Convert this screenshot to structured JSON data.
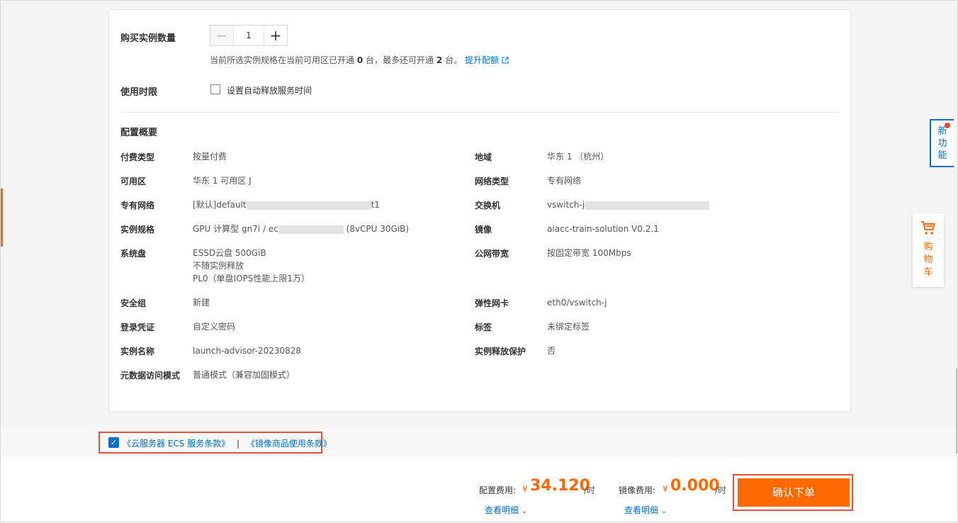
{
  "purchase": {
    "quantity_label": "购买实例数量",
    "quantity_value": "1",
    "quota_prefix": "当前所选实例规格在当前可用区已开通",
    "quota_open": "0",
    "quota_mid": "台，最多还可开通",
    "quota_more": "2",
    "quota_suffix": "台。",
    "quota_link": "提升配额"
  },
  "release": {
    "label": "使用时限",
    "checkbox_text": "设置自动释放服务时间"
  },
  "summary": {
    "title": "配置概要",
    "left": [
      {
        "key": "付费类型",
        "value": "按量付费"
      },
      {
        "key": "可用区",
        "value": "华东 1 可用区 J"
      },
      {
        "key": "专有网络",
        "value_prefix": "[默认]default",
        "value_suffix": "t1"
      },
      {
        "key": "实例规格",
        "value_prefix": "GPU 计算型 gn7i / ec",
        "value_suffix": "(8vCPU 30GiB)"
      },
      {
        "key": "系统盘",
        "lines": [
          "ESSD云盘 500GiB",
          "不随实例释放",
          "PL0（单盘IOPS性能上限1万）"
        ]
      },
      {
        "key": "安全组",
        "value": "新建"
      },
      {
        "key": "登录凭证",
        "value": "自定义密码"
      },
      {
        "key": "实例名称",
        "value": "launch-advisor-20230828"
      },
      {
        "key": "元数据访问模式",
        "value": "普通模式（兼容加固模式）"
      }
    ],
    "right": [
      {
        "key": "地域",
        "value": "华东 1 （杭州）"
      },
      {
        "key": "网络类型",
        "value": "专有网络"
      },
      {
        "key": "交换机",
        "value_prefix": "vswitch-j"
      },
      {
        "key": "镜像",
        "value": "aiacc-train-solution V0.2.1"
      },
      {
        "key": "公网带宽",
        "value": "按固定带宽 100Mbps"
      },
      {
        "key": "弹性网卡",
        "value": "eth0/vswitch-j"
      },
      {
        "key": "标签",
        "value": "未绑定标签"
      },
      {
        "key": "实例释放保护",
        "value": "否"
      }
    ]
  },
  "terms": {
    "ecs_terms": "《云服务器 ECS 服务条款》",
    "separator": "|",
    "image_terms": "《镜像商品使用条款》"
  },
  "footer": {
    "config_fee_label": "配置费用:",
    "config_fee_currency": "¥",
    "config_fee_amount": "34.120",
    "config_fee_unit": "/时",
    "image_fee_label": "镜像费用:",
    "image_fee_currency": "¥",
    "image_fee_amount": "0.000",
    "image_fee_unit": "/时",
    "detail_link": "查看明细",
    "confirm_label": "确认下单"
  },
  "side": {
    "new_feature": [
      "新",
      "功",
      "能"
    ],
    "cart": [
      "购",
      "物",
      "车"
    ]
  },
  "colors": {
    "accent": "#ff6a00",
    "link": "#0070cc",
    "highlight": "#e94f3b"
  }
}
